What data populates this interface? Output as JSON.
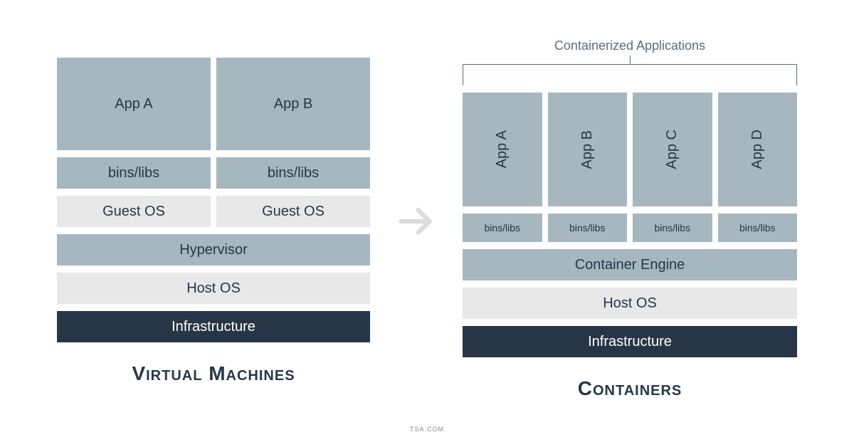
{
  "left": {
    "title": "Virtual Machines",
    "apps": [
      "App A",
      "App B"
    ],
    "bins": [
      "bins/libs",
      "bins/libs"
    ],
    "guest": [
      "Guest OS",
      "Guest OS"
    ],
    "hypervisor": "Hypervisor",
    "host": "Host OS",
    "infra": "Infrastructure"
  },
  "right": {
    "title": "Containers",
    "bracket": "Containerized Applications",
    "apps": [
      "App A",
      "App B",
      "App C",
      "App D"
    ],
    "bins": [
      "bins/libs",
      "bins/libs",
      "bins/libs",
      "bins/libs"
    ],
    "engine": "Container Engine",
    "host": "Host OS",
    "infra": "Infrastructure"
  },
  "footer": "TSA.COM"
}
